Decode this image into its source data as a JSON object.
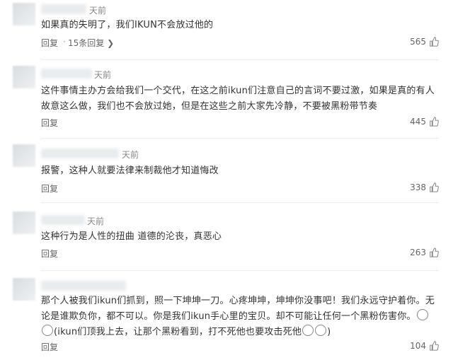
{
  "comments": [
    {
      "time": "天前",
      "text": "如果真的失明了，我们IKUN不会放过他的",
      "reply_label": "回复",
      "subreplies_label": "15条回复",
      "likes": "565"
    },
    {
      "time": "天前",
      "text": "这件事情主办方会给我们一个交代，在这之前ikun们注意自己的言词不要过激，如果是真的有人故意这么做，我们也不会放过她，但是在这些之前大家先冷静，不要被黑粉带节奏",
      "reply_label": "回复",
      "likes": "445"
    },
    {
      "time": "天前",
      "text": "报警，这种人就要法律来制裁他才知道悔改",
      "reply_label": "回复",
      "likes": "338"
    },
    {
      "time": "天前",
      "text": "这种行为是人性的扭曲 道德的沦丧，真恶心",
      "reply_label": "回复",
      "likes": "263"
    },
    {
      "text_a": "那个人被我们ikun们抓到，照一下坤坤一刀。心疼坤坤，坤坤你没事吧！我们永远守护着你。无论是谁欺负你，都不可以。你是我们ikun手心里的宝贝。却不可能让任何一个黑粉伤害你。",
      "text_b": "(ikun们顶我上去，让那个黑粉看到，打不死他也要攻击死他",
      "text_c": ")",
      "reply_label": "回复",
      "likes": "104"
    }
  ],
  "icons": {
    "thumb": "thumbs-up-icon",
    "emoji": "emoji-face-icon"
  },
  "colors": {
    "text": "#333333",
    "meta": "#888888",
    "divider": "#eceef0"
  }
}
